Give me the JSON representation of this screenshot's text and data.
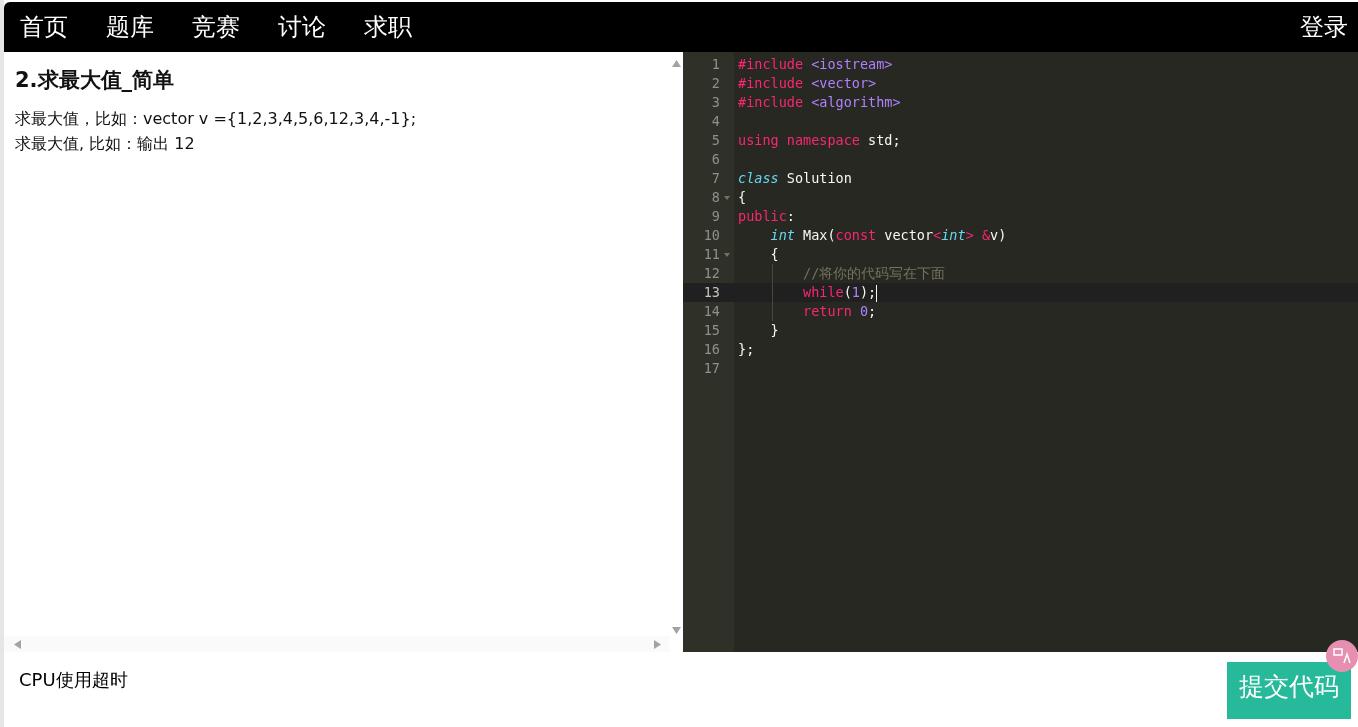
{
  "nav": {
    "items": [
      {
        "label": "首页"
      },
      {
        "label": "题库"
      },
      {
        "label": "竞赛"
      },
      {
        "label": "讨论"
      },
      {
        "label": "求职"
      }
    ],
    "login": "登录"
  },
  "problem": {
    "title": "2.求最大值_简单",
    "lines": [
      "求最大值，比如：vector v ={1,2,3,4,5,6,12,3,4,-1};",
      "求最大值, 比如：输出 12"
    ]
  },
  "editor": {
    "lines": [
      {
        "number": "1",
        "fold": false,
        "active": false,
        "guide": false,
        "tokens": [
          {
            "kind": "keyword",
            "text": "#include"
          },
          {
            "kind": "string",
            "text": " <iostream>"
          }
        ]
      },
      {
        "number": "2",
        "fold": false,
        "active": false,
        "guide": false,
        "tokens": [
          {
            "kind": "keyword",
            "text": "#include"
          },
          {
            "kind": "string",
            "text": " <vector>"
          }
        ]
      },
      {
        "number": "3",
        "fold": false,
        "active": false,
        "guide": false,
        "tokens": [
          {
            "kind": "keyword",
            "text": "#include"
          },
          {
            "kind": "string",
            "text": " <algorithm>"
          }
        ]
      },
      {
        "number": "4",
        "fold": false,
        "active": false,
        "guide": false
      },
      {
        "number": "5",
        "fold": false,
        "active": false,
        "guide": false,
        "tokens": [
          {
            "kind": "keyword",
            "text": "using namespace"
          },
          {
            "kind": "plain",
            "text": " std;"
          }
        ]
      },
      {
        "number": "6",
        "fold": false,
        "active": false,
        "guide": false
      },
      {
        "number": "7",
        "fold": false,
        "active": false,
        "guide": false,
        "tokens": [
          {
            "kind": "type",
            "text": "class"
          },
          {
            "kind": "plain",
            "text": " Solution"
          }
        ]
      },
      {
        "number": "8",
        "fold": true,
        "active": false,
        "guide": false,
        "tokens": [
          {
            "kind": "plain",
            "text": "{"
          }
        ]
      },
      {
        "number": "9",
        "fold": false,
        "active": false,
        "guide": false,
        "tokens": [
          {
            "kind": "keyword",
            "text": "public"
          },
          {
            "kind": "plain",
            "text": ":"
          }
        ]
      },
      {
        "number": "10",
        "fold": false,
        "active": false,
        "guide": false,
        "tokens": [
          {
            "kind": "type",
            "text": "    int"
          },
          {
            "kind": "plain",
            "text": " Max("
          },
          {
            "kind": "keyword",
            "text": "const"
          },
          {
            "kind": "plain",
            "text": " vector"
          },
          {
            "kind": "keyword",
            "text": "<"
          },
          {
            "kind": "type",
            "text": "int"
          },
          {
            "kind": "keyword",
            "text": "> &"
          },
          {
            "kind": "plain",
            "text": "v)"
          }
        ]
      },
      {
        "number": "11",
        "fold": true,
        "active": false,
        "guide": false,
        "tokens": [
          {
            "kind": "plain",
            "text": "    {"
          }
        ]
      },
      {
        "number": "12",
        "fold": false,
        "active": false,
        "guide": true,
        "tokens": [
          {
            "kind": "comment",
            "text": "        //将你的代码写在下面"
          }
        ]
      },
      {
        "number": "13",
        "fold": false,
        "active": true,
        "guide": true,
        "tokens": [
          {
            "kind": "keyword",
            "text": "        while"
          },
          {
            "kind": "plain",
            "text": "("
          },
          {
            "kind": "number",
            "text": "1"
          },
          {
            "kind": "plain",
            "text": ");"
          }
        ]
      },
      {
        "number": "14",
        "fold": false,
        "active": false,
        "guide": true,
        "tokens": [
          {
            "kind": "keyword",
            "text": "        return"
          },
          {
            "kind": "number",
            "text": " 0"
          },
          {
            "kind": "plain",
            "text": ";"
          }
        ]
      },
      {
        "number": "15",
        "fold": false,
        "active": false,
        "guide": false,
        "tokens": [
          {
            "kind": "plain",
            "text": "    }"
          }
        ]
      },
      {
        "number": "16",
        "fold": false,
        "active": false,
        "guide": false,
        "tokens": [
          {
            "kind": "plain",
            "text": "};"
          }
        ]
      },
      {
        "number": "17",
        "fold": false,
        "active": false,
        "guide": false
      }
    ]
  },
  "result": "CPU使用超时",
  "submit": "提交代码"
}
